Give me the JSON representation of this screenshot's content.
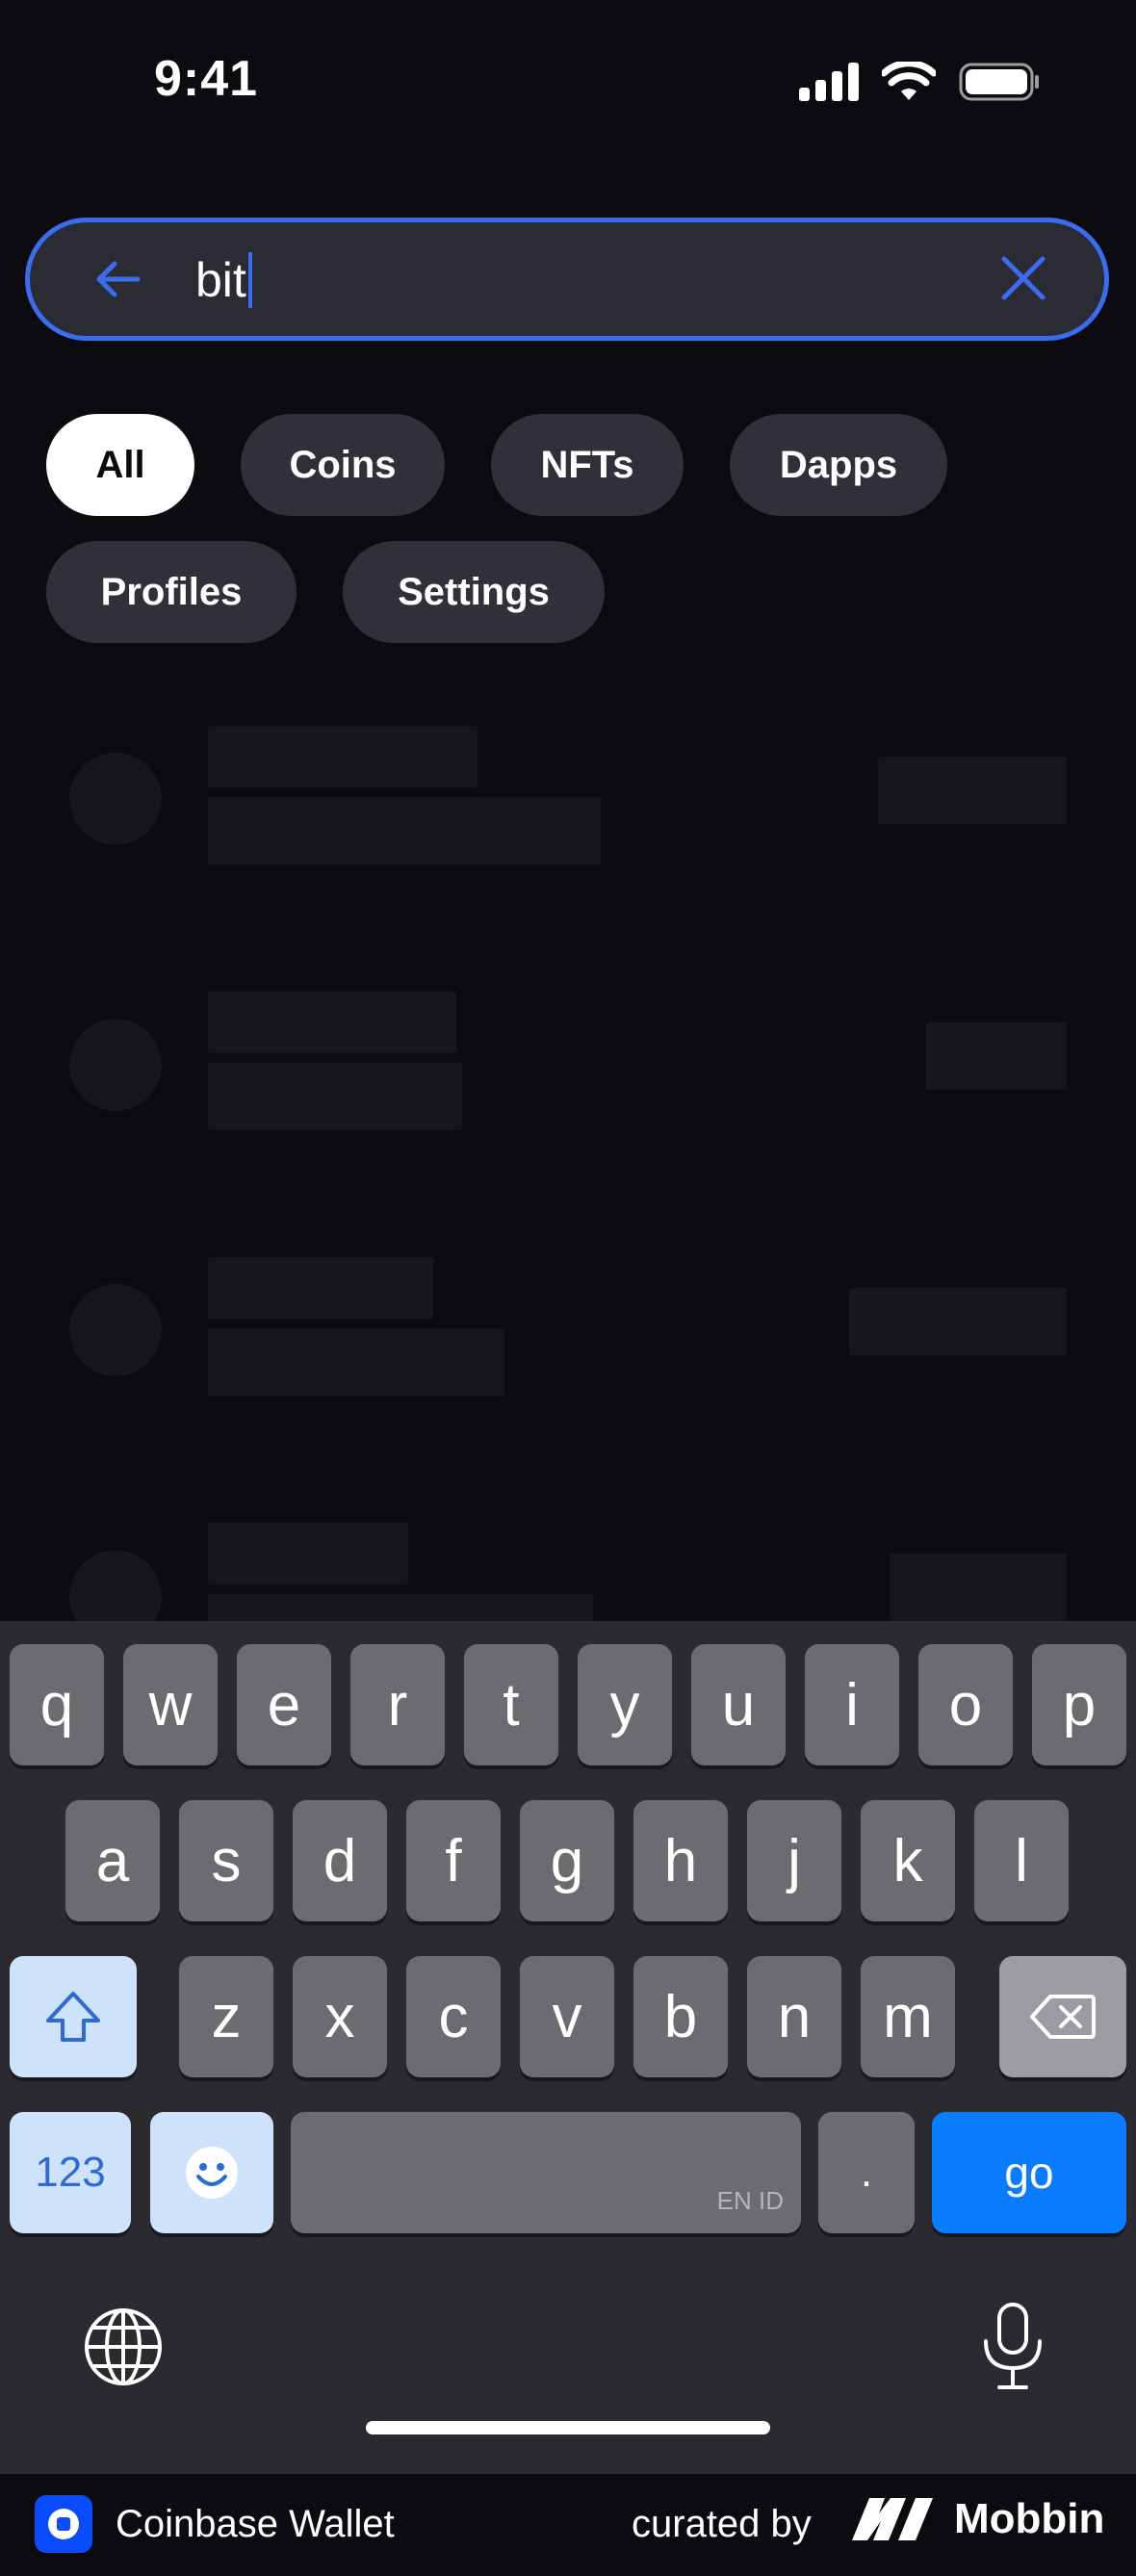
{
  "status_bar": {
    "time": "9:41"
  },
  "search": {
    "query": "bit"
  },
  "filters": [
    {
      "label": "All",
      "active": true
    },
    {
      "label": "Coins",
      "active": false
    },
    {
      "label": "NFTs",
      "active": false
    },
    {
      "label": "Dapps",
      "active": false
    },
    {
      "label": "Profiles",
      "active": false
    },
    {
      "label": "Settings",
      "active": false
    }
  ],
  "keyboard": {
    "row1": [
      "q",
      "w",
      "e",
      "r",
      "t",
      "y",
      "u",
      "i",
      "o",
      "p"
    ],
    "row2": [
      "a",
      "s",
      "d",
      "f",
      "g",
      "h",
      "j",
      "k",
      "l"
    ],
    "row3": [
      "z",
      "x",
      "c",
      "v",
      "b",
      "n",
      "m"
    ],
    "numbers_key": "123",
    "period_key": ".",
    "space_language_hint": "EN ID",
    "go_key": "go"
  },
  "footer": {
    "app_name": "Coinbase Wallet",
    "curated_by": "curated by",
    "brand": "Mobbin"
  },
  "colors": {
    "accent": "#3a6cf0",
    "background": "#0b0b10",
    "chip": "#2f3038",
    "go_key": "#0a7cff"
  }
}
